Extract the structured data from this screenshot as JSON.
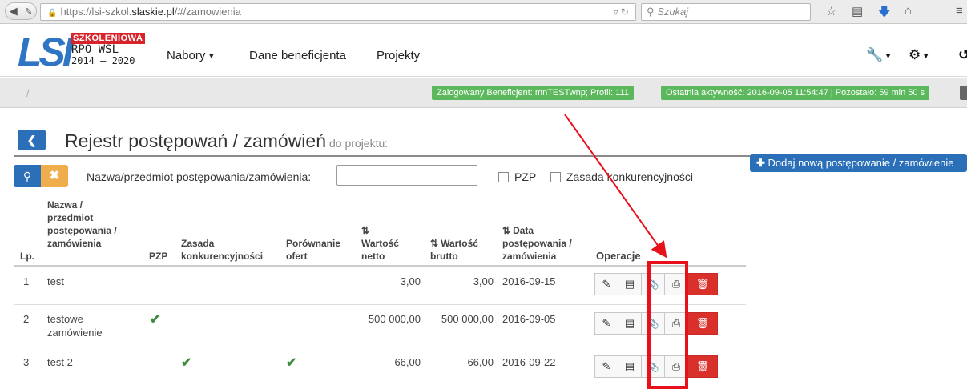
{
  "browser": {
    "url_prefix": "https://lsi-szkol.",
    "url_domain": "slaskie.pl",
    "url_suffix": "/#/zamowienia",
    "search_placeholder": "Szukaj"
  },
  "header": {
    "logo_lsi": "LSI",
    "logo_badge": "SZKOLENIOWA",
    "logo_rpo": "RPO WSL",
    "logo_years": "2014 – 2020",
    "menu": [
      {
        "label": "Nabory"
      },
      {
        "label": "Dane beneficjenta"
      },
      {
        "label": "Projekty"
      }
    ]
  },
  "infobar": {
    "breadcrumb": "/",
    "login_badge": "Zalogowany Beneficjent: mnTESTwnp; Profil: 111",
    "activity_badge": "Ostatnia aktywność: 2016-09-05 11:54:47 | Pozostało: 59 min 50 s"
  },
  "page": {
    "title": "Rejestr postępowań / zamówień",
    "title_suffix": "do projektu:",
    "add_button": "Dodaj nową postępowanie / zamówienie"
  },
  "filters": {
    "name_label": "Nazwa/przedmiot postępowania/zamówienia:",
    "name_value": "",
    "pzp_label": "PZP",
    "competition_label": "Zasada konkurencyjności"
  },
  "table": {
    "headers": {
      "lp": "Lp.",
      "name_l1": "Nazwa /",
      "name_l2": "przedmiot",
      "name_l3": "postępowania /",
      "name_l4": "zamówienia",
      "pzp": "PZP",
      "comp_l1": "Zasada",
      "comp_l2": "konkurencyjności",
      "cmp_l1": "Porównanie",
      "cmp_l2": "ofert",
      "net_l1": "Wartość",
      "net_l2": "netto",
      "gross_l1": "Wartość",
      "gross_l2": "brutto",
      "date_l1": "Data",
      "date_l2": "postępowania /",
      "date_l3": "zamówienia",
      "ops": "Operacje"
    },
    "rows": [
      {
        "lp": "1",
        "name": "test",
        "name2": "",
        "net": "3,00",
        "gross": "3,00",
        "date": "2016-09-15"
      },
      {
        "lp": "2",
        "name": "testowe",
        "name2": "zamówienie",
        "net": "500 000,00",
        "gross": "500 000,00",
        "date": "2016-09-05"
      },
      {
        "lp": "3",
        "name": "test 2",
        "name2": "",
        "net": "66,00",
        "gross": "66,00",
        "date": "2016-09-22"
      }
    ]
  },
  "colors": {
    "primary": "#2a6fb8",
    "warning": "#f0ad4e",
    "success": "#5cb85c",
    "danger": "#d9302c",
    "annotation": "#e8101a"
  },
  "icons": {
    "edit": "edit-icon",
    "details": "list-icon",
    "attachments": "paperclip-icon",
    "print": "print-icon",
    "delete": "trash-icon"
  }
}
